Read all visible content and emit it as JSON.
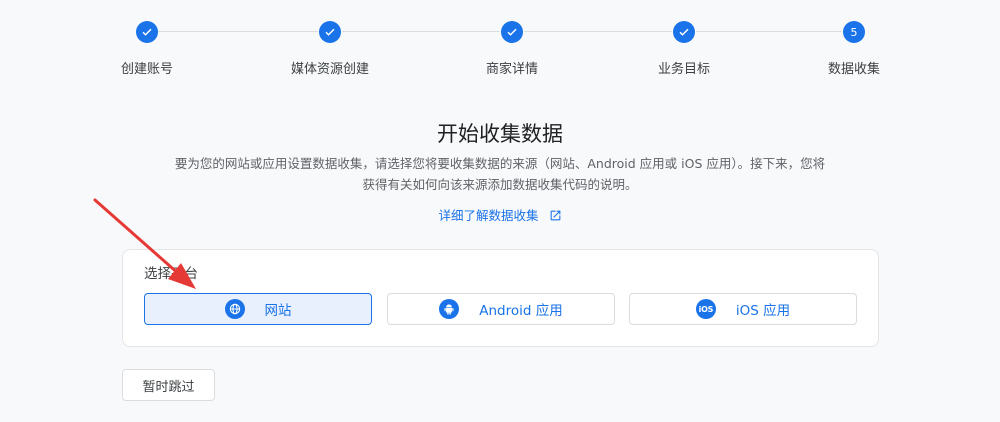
{
  "stepper": {
    "steps": [
      {
        "label": "创建账号",
        "state": "done",
        "icon": "check-icon"
      },
      {
        "label": "媒体资源创建",
        "state": "done",
        "icon": "check-icon"
      },
      {
        "label": "商家详情",
        "state": "done",
        "icon": "check-icon"
      },
      {
        "label": "业务目标",
        "state": "done",
        "icon": "check-icon"
      },
      {
        "label": "数据收集",
        "state": "current",
        "number": "5"
      }
    ]
  },
  "main": {
    "title": "开始收集数据",
    "description_line1": "要为您的网站或应用设置数据收集，请选择您将要收集数据的来源（网站、Android 应用或 iOS 应用）。接下来，您将",
    "description_line2": "获得有关如何向该来源添加数据收集代码的说明。",
    "learn_more": "详细了解数据收集",
    "learn_more_icon": "open-in-new-icon"
  },
  "platform": {
    "title": "选择平台",
    "options": [
      {
        "label": "网站",
        "icon": "globe-icon",
        "selected": true
      },
      {
        "label": "Android 应用",
        "icon": "android-icon",
        "selected": false
      },
      {
        "label": "iOS 应用",
        "icon": "ios-icon",
        "icon_text": "iOS",
        "selected": false
      }
    ]
  },
  "skip_label": "暂时跳过",
  "annotation": {
    "icon": "red-arrow-icon",
    "color": "#e53935"
  },
  "colors": {
    "accent": "#1a73e8",
    "background": "#f8f9fa",
    "selected_bg": "#e8f0fe"
  }
}
